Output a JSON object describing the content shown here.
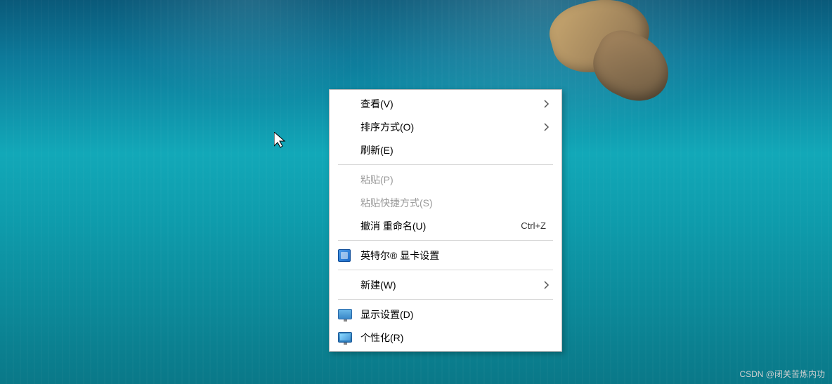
{
  "menu": {
    "view": {
      "label": "查看(V)"
    },
    "sort": {
      "label": "排序方式(O)"
    },
    "refresh": {
      "label": "刷新(E)"
    },
    "paste": {
      "label": "粘贴(P)"
    },
    "paste_shortcut": {
      "label": "粘贴快捷方式(S)"
    },
    "undo": {
      "label": "撤消 重命名(U)",
      "shortcut": "Ctrl+Z"
    },
    "intel": {
      "label": "英特尔® 显卡设置"
    },
    "new": {
      "label": "新建(W)"
    },
    "display": {
      "label": "显示设置(D)"
    },
    "personalize": {
      "label": "个性化(R)"
    }
  },
  "watermark": "CSDN @闭关苦炼内功"
}
